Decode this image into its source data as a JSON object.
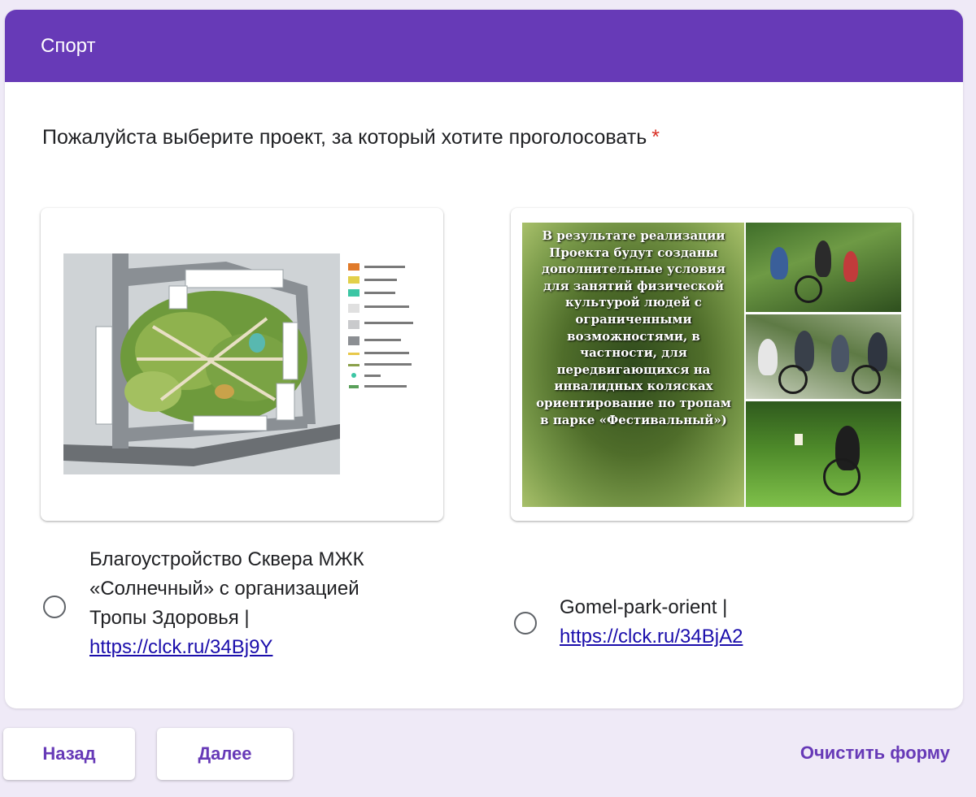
{
  "section": {
    "title": "Спорт"
  },
  "question": {
    "text": "Пожалуйста выберите проект, за который хотите проголосовать",
    "required_mark": "*"
  },
  "options": [
    {
      "title_lines": [
        "Благоустройство Сквера МЖК",
        "«Солнечный» с организацией",
        "Тропы Здоровья |"
      ],
      "link": "https://clck.ru/34Bj9Y"
    },
    {
      "title_lines": [
        "Gomel-park-orient |"
      ],
      "link": "https://clck.ru/34BjA2",
      "image_text": [
        "В результате реализации",
        "Проекта будут созданы",
        "дополнительные  условия",
        "для занятий физической",
        "культурой людей с",
        "ограниченными",
        "возможностями, в",
        "частности, для",
        "передвигающихся на",
        "инвалидных колясках",
        "ориентирование по тропам",
        "в парке «Фестивальный»)"
      ]
    }
  ],
  "buttons": {
    "back": "Назад",
    "next": "Далее",
    "clear": "Очистить форму"
  },
  "colors": {
    "accent": "#673ab7",
    "background": "#efeaf7",
    "required": "#d93025",
    "link": "#1a0dab"
  }
}
